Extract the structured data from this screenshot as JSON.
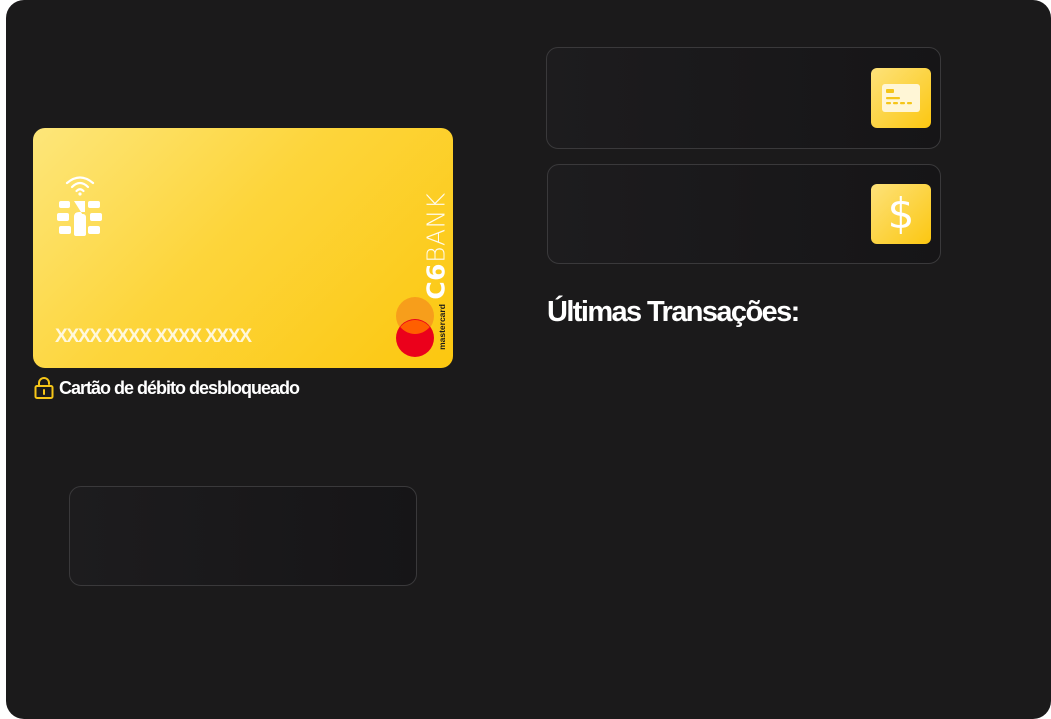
{
  "card": {
    "brand_logo": "C6",
    "brand_name": "BANK",
    "number_mask": "XXXX XXXX XXXX XXXX",
    "network_label": "mastercard"
  },
  "status": {
    "label": "Cartão de débito desbloqueado",
    "icon": "unlocked-padlock-icon"
  },
  "transactions": {
    "title": "Últimas Transações:"
  },
  "tiles": {
    "card_icon": "credit-card-icon",
    "money_symbol": "$"
  },
  "colors": {
    "background": "#1b1a1b",
    "card_gradient_start": "#fde67a",
    "card_gradient_end": "#fcc70f",
    "accent_yellow": "#fcc711",
    "mastercard_red": "#eb001b",
    "mastercard_orange": "#f79e1b",
    "text_primary": "#ffffff"
  }
}
